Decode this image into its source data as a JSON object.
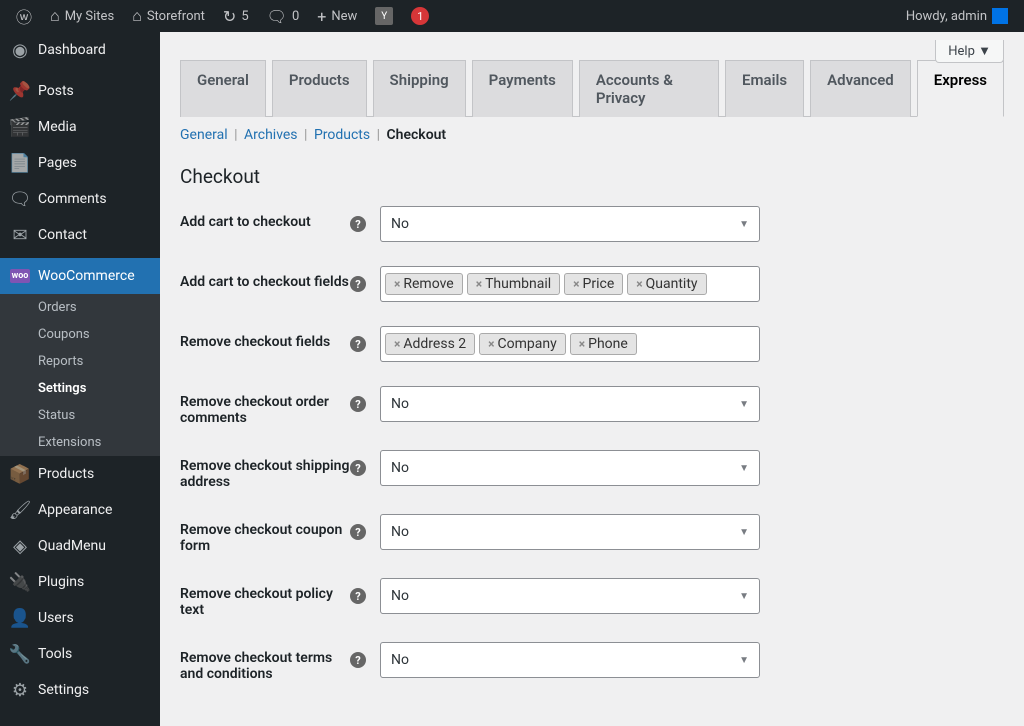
{
  "topbar": {
    "my_sites": "My Sites",
    "site_name": "Storefront",
    "updates": "5",
    "comments": "0",
    "new": "New",
    "notif": "1",
    "howdy": "Howdy, admin"
  },
  "sidebar": {
    "items": [
      {
        "label": "Dashboard",
        "icon": "dashboard"
      },
      {
        "label": "Posts",
        "icon": "pin"
      },
      {
        "label": "Media",
        "icon": "media"
      },
      {
        "label": "Pages",
        "icon": "page"
      },
      {
        "label": "Comments",
        "icon": "comment"
      },
      {
        "label": "Contact",
        "icon": "mail"
      },
      {
        "label": "WooCommerce",
        "icon": "woo",
        "current": true
      },
      {
        "label": "Products",
        "icon": "product"
      },
      {
        "label": "Appearance",
        "icon": "brush"
      },
      {
        "label": "QuadMenu",
        "icon": "quad"
      },
      {
        "label": "Plugins",
        "icon": "plug"
      },
      {
        "label": "Users",
        "icon": "users"
      },
      {
        "label": "Tools",
        "icon": "tools"
      },
      {
        "label": "Settings",
        "icon": "settings"
      }
    ],
    "submenu": [
      {
        "label": "Orders"
      },
      {
        "label": "Coupons"
      },
      {
        "label": "Reports"
      },
      {
        "label": "Settings",
        "current": true
      },
      {
        "label": "Status"
      },
      {
        "label": "Extensions"
      }
    ]
  },
  "help": "Help",
  "tabs": [
    "General",
    "Products",
    "Shipping",
    "Payments",
    "Accounts & Privacy",
    "Emails",
    "Advanced",
    "Express"
  ],
  "active_tab": "Express",
  "breadcrumb": {
    "general": "General",
    "archives": "Archives",
    "products": "Products",
    "checkout": "Checkout"
  },
  "section_title": "Checkout",
  "fields": {
    "add_cart": {
      "label": "Add cart to checkout",
      "value": "No"
    },
    "add_cart_fields": {
      "label": "Add cart to checkout fields",
      "tags": [
        "Remove",
        "Thumbnail",
        "Price",
        "Quantity"
      ]
    },
    "remove_fields": {
      "label": "Remove checkout fields",
      "tags": [
        "Address 2",
        "Company",
        "Phone"
      ]
    },
    "remove_comments": {
      "label": "Remove checkout order comments",
      "value": "No"
    },
    "remove_shipping": {
      "label": "Remove checkout shipping address",
      "value": "No"
    },
    "remove_coupon": {
      "label": "Remove checkout coupon form",
      "value": "No"
    },
    "remove_policy": {
      "label": "Remove checkout policy text",
      "value": "No"
    },
    "remove_terms": {
      "label": "Remove checkout terms and conditions",
      "value": "No"
    }
  }
}
